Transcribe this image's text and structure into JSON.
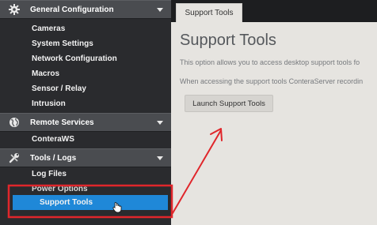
{
  "colors": {
    "accent": "#1f88d8",
    "annotation": "#e0262b",
    "sidebar_bg": "#2a2b2e",
    "panel_bg": "#e6e4e0"
  },
  "sidebar": {
    "groups": [
      {
        "label": "General Configuration",
        "icon": "gear-icon"
      },
      {
        "label": "Remote Services",
        "icon": "globe-icon"
      },
      {
        "label": "Tools / Logs",
        "icon": "wrench-icon"
      }
    ],
    "general_items": [
      "Cameras",
      "System Settings",
      "Network Configuration",
      "Macros",
      "Sensor / Relay",
      "Intrusion"
    ],
    "remote_items": [
      "ConteraWS"
    ],
    "tools_items": [
      "Log Files",
      "Power Options",
      "Support Tools"
    ],
    "selected": "Support Tools"
  },
  "tab": {
    "label": "Support Tools"
  },
  "main": {
    "title": "Support Tools",
    "desc1": "This option allows you to access desktop support tools fo",
    "desc2": "When accessing the support tools ConteraServer recordin",
    "launch_label": "Launch Support Tools"
  }
}
